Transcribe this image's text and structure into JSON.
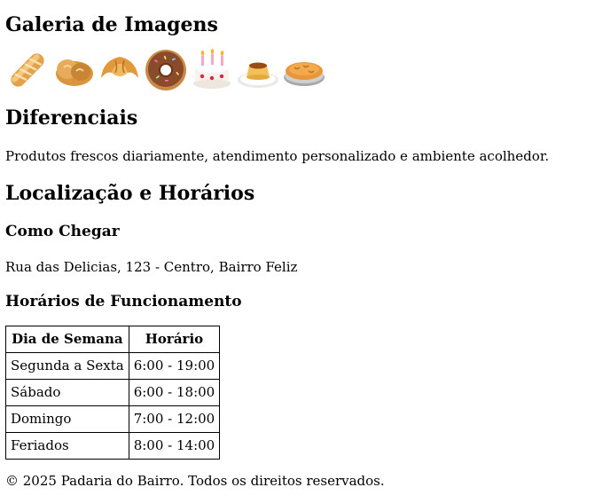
{
  "gallery": {
    "title": "Galeria de Imagens",
    "images": [
      {
        "icon": "baguette-icon",
        "glyph": "🥖"
      },
      {
        "icon": "bread-roll-icon",
        "glyph": "🥯"
      },
      {
        "icon": "croissant-icon",
        "glyph": "🥐"
      },
      {
        "icon": "donut-icon",
        "glyph": "🍩"
      },
      {
        "icon": "birthday-cake-icon",
        "glyph": "🎂"
      },
      {
        "icon": "flan-icon",
        "glyph": "🍮"
      },
      {
        "icon": "pie-icon",
        "glyph": "🥧"
      }
    ]
  },
  "differentials": {
    "title": "Diferenciais",
    "text": "Produtos frescos diariamente, atendimento personalizado e ambiente acolhedor."
  },
  "location": {
    "title": "Localização e Horários",
    "directions_title": "Como Chegar",
    "address": "Rua das Delicias, 123 - Centro, Bairro Feliz",
    "hours_title": "Horários de Funcionamento",
    "table": {
      "headers": [
        "Dia de Semana",
        "Horário"
      ],
      "rows": [
        [
          "Segunda a Sexta",
          "6:00 - 19:00"
        ],
        [
          "Sábado",
          "6:00 - 18:00"
        ],
        [
          "Domingo",
          "7:00 - 12:00"
        ],
        [
          "Feriados",
          "8:00 - 14:00"
        ]
      ]
    }
  },
  "footer": {
    "text": "© 2025 Padaria do Bairro. Todos os direitos reservados."
  },
  "colors": {
    "text": "#000000",
    "background": "#ffffff",
    "border": "#000000"
  }
}
